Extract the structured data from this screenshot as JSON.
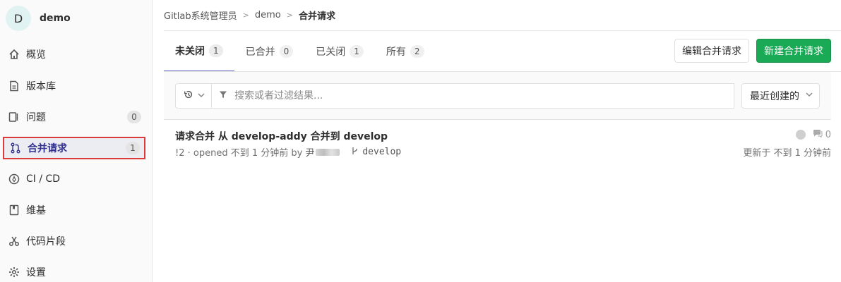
{
  "project": {
    "initial": "D",
    "name": "demo"
  },
  "sidebar": {
    "items": [
      {
        "label": "概览",
        "icon": "home-icon"
      },
      {
        "label": "版本库",
        "icon": "document-icon"
      },
      {
        "label": "问题",
        "icon": "issues-icon",
        "count": "0"
      },
      {
        "label": "合并请求",
        "icon": "merge-request-icon",
        "count": "1",
        "active": true
      },
      {
        "label": "CI / CD",
        "icon": "rocket-icon"
      },
      {
        "label": "维基",
        "icon": "book-icon"
      },
      {
        "label": "代码片段",
        "icon": "scissors-icon"
      },
      {
        "label": "设置",
        "icon": "gear-icon"
      }
    ]
  },
  "breadcrumb": {
    "group": "Gitlab系统管理员",
    "project": "demo",
    "current": "合并请求"
  },
  "tabs": [
    {
      "label": "未关闭",
      "count": "1",
      "active": true
    },
    {
      "label": "已合并",
      "count": "0"
    },
    {
      "label": "已关闭",
      "count": "1"
    },
    {
      "label": "所有",
      "count": "2"
    }
  ],
  "actions": {
    "edit_label": "编辑合并请求",
    "new_label": "新建合并请求"
  },
  "filter": {
    "placeholder": "搜索或者过滤结果...",
    "sort_label": "最近创建的"
  },
  "merge_request": {
    "title": "请求合并 从 develop-addy 合并到 develop",
    "meta_prefix": "!2 · opened 不到 1 分钟前 by",
    "author": "尹",
    "target_branch": "develop",
    "comments": "0",
    "updated": "更新于 不到 1 分钟前"
  },
  "colors": {
    "accent": "#6666c4",
    "primary_button": "#1aaa55",
    "active_border": "#db3b3b"
  }
}
